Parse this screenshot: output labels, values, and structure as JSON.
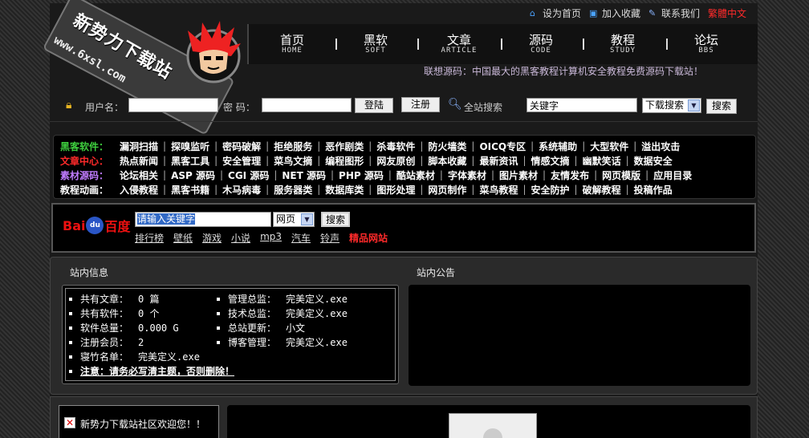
{
  "logo": {
    "title": "新势力下载站",
    "url": "www.6xsl.com"
  },
  "topbar": {
    "home": "设为首页",
    "favorite": "加入收藏",
    "contact": "联系我们",
    "lang": "繁體中文"
  },
  "nav": [
    {
      "cn": "首页",
      "en": "HOME"
    },
    {
      "cn": "黑软",
      "en": "SOFT"
    },
    {
      "cn": "文章",
      "en": "ARTICLE"
    },
    {
      "cn": "源码",
      "en": "CODE"
    },
    {
      "cn": "教程",
      "en": "STUDY"
    },
    {
      "cn": "论坛",
      "en": "BBS"
    }
  ],
  "marquee": "联想源码：中国最大的黑客教程计算机安全教程免费源码下载站！",
  "login": {
    "user_label": "用户名：",
    "pass_label": "密 码：",
    "login_btn": "登陆",
    "register_btn": "注册",
    "site_search": "全站搜索",
    "keyword": "关键字",
    "search_type": "下载搜索",
    "search_btn": "搜索"
  },
  "categories": [
    {
      "label": "黑客软件：",
      "color": "#3ecf3e",
      "links": [
        "漏洞扫描",
        "探嗅监听",
        "密码破解",
        "拒绝服务",
        "恶作剧类",
        "杀毒软件",
        "防火墙类",
        "OICQ专区",
        "系统辅助",
        "大型软件",
        "溢出攻击"
      ]
    },
    {
      "label": "文章中心：",
      "color": "#ff2a2a",
      "links": [
        "热点新闻",
        "黑客工具",
        "安全管理",
        "菜鸟文摘",
        "编程图形",
        "网友原创",
        "脚本收藏",
        "最新资讯",
        "情感文摘",
        "幽默笑话",
        "数据安全"
      ]
    },
    {
      "label": "素材源码：",
      "color": "#c07cff",
      "links": [
        "论坛相关",
        "ASP 源码",
        "CGI 源码",
        "NET 源码",
        "PHP 源码",
        "酷站素材",
        "字体素材",
        "图片素材",
        "友情发布",
        "网页模版",
        "应用目录"
      ]
    },
    {
      "label": "教程动画：",
      "color": "#ffffff",
      "links": [
        "入侵教程",
        "黑客书籍",
        "木马病毒",
        "服务器类",
        "数据库类",
        "图形处理",
        "网页制作",
        "菜鸟教程",
        "安全防护",
        "破解教程",
        "投稿作品"
      ]
    }
  ],
  "baidu": {
    "logo_bai": "Bai",
    "logo_du": "du",
    "logo_cn": "百度",
    "input": "请输入关键字",
    "scope": "网页",
    "btn": "搜索",
    "links": [
      "排行榜",
      "壁纸",
      "游戏",
      "小说",
      "mp3",
      "汽车",
      "铃声"
    ],
    "hot": "精品网站"
  },
  "info": {
    "title": "站内信息",
    "notice_title": "站内公告",
    "rows": [
      {
        "k": "共有文章：",
        "v": "0 篇"
      },
      {
        "k": "共有软件：",
        "v": "0 个"
      },
      {
        "k": "软件总量：",
        "v": "0.000 G"
      },
      {
        "k": "注册会员：",
        "v": "2"
      },
      {
        "k": "管理总监：",
        "v": "完美定义.exe"
      },
      {
        "k": "技术总监：",
        "v": "完美定义.exe"
      },
      {
        "k": "总站更新：",
        "v": "小文"
      },
      {
        "k": "博客管理：",
        "v": "完美定义.exe"
      },
      {
        "k": "寝竹名单：",
        "v": "完美定义.exe"
      }
    ],
    "note": "注意：请务必写清主题，否则删除！"
  },
  "welcome": "新势力下载站社区欢迎您！！"
}
